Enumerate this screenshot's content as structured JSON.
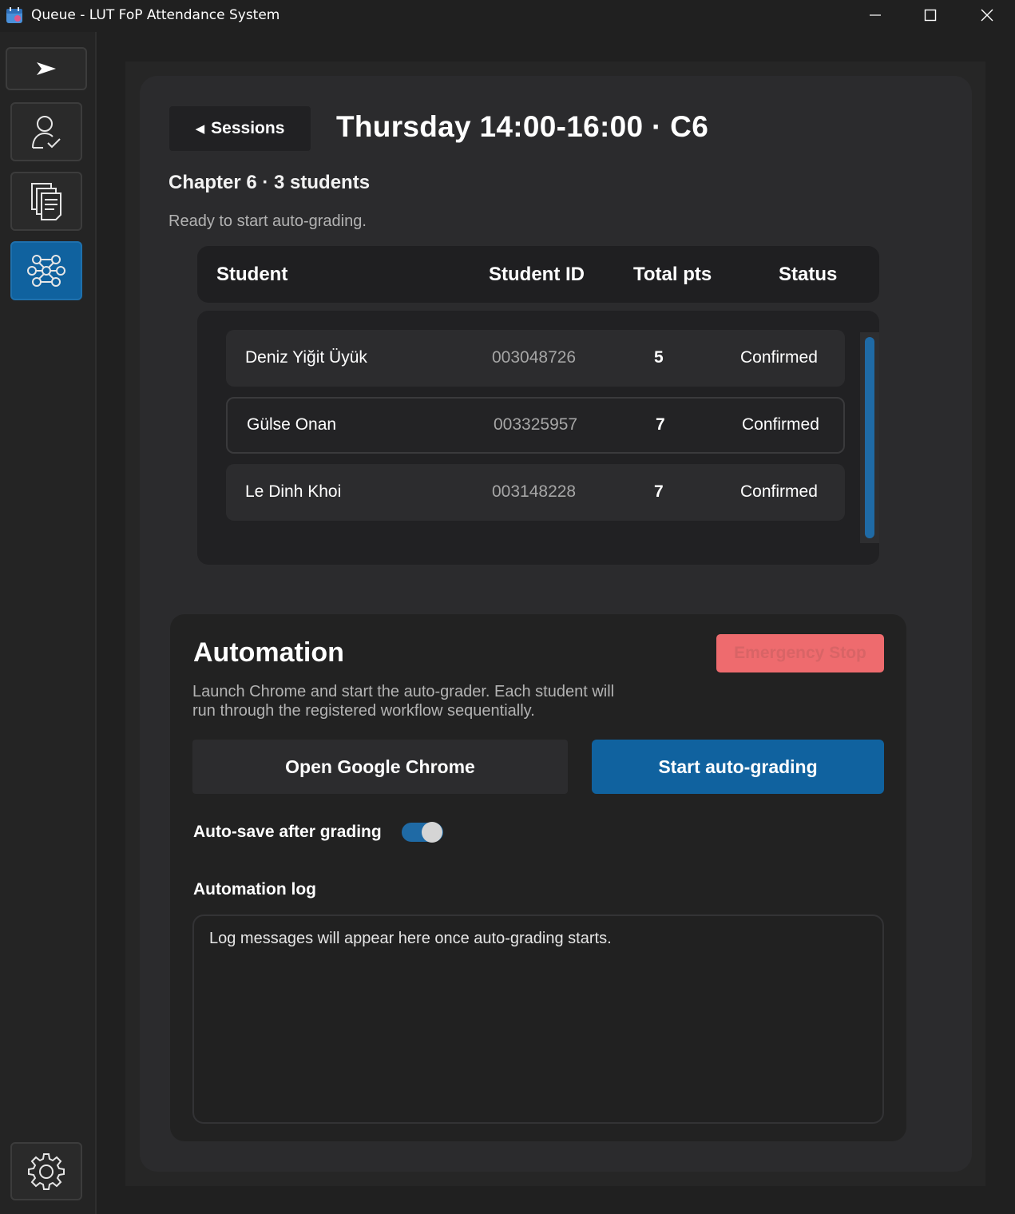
{
  "window": {
    "title": "Queue - LUT FoP Attendance System"
  },
  "sidebar": {
    "items": [
      {
        "icon": "send-arrow-icon",
        "active": false
      },
      {
        "icon": "user-check-icon",
        "active": false
      },
      {
        "icon": "documents-icon",
        "active": false
      },
      {
        "icon": "network-graph-icon",
        "active": true
      },
      {
        "icon": "gear-icon",
        "active": false
      }
    ]
  },
  "header": {
    "back_label": "Sessions",
    "title": "Thursday 14:00-16:00 · C6",
    "subheading": "Chapter 6 · 3 students",
    "status": "Ready to start auto-grading."
  },
  "table": {
    "columns": [
      "Student",
      "Student ID",
      "Total pts",
      "Status"
    ],
    "rows": [
      {
        "name": "Deniz Yiğit Üyük",
        "id": "003048726",
        "pts": "5",
        "status": "Confirmed"
      },
      {
        "name": "Gülse Onan",
        "id": "003325957",
        "pts": "7",
        "status": "Confirmed"
      },
      {
        "name": "Le Dinh Khoi",
        "id": "003148228",
        "pts": "7",
        "status": "Confirmed"
      }
    ]
  },
  "automation": {
    "title": "Automation",
    "emergency_label": "Emergency Stop",
    "description": "Launch Chrome and start the auto-grader. Each student will run through the registered workflow sequentially.",
    "open_chrome_label": "Open Google Chrome",
    "start_label": "Start auto-grading",
    "autosave_label": "Auto-save after grading",
    "autosave_on": true,
    "log_label": "Automation log",
    "log_text": "Log messages will appear here once auto-grading starts."
  },
  "colors": {
    "accent": "#10629f",
    "danger": "#ee6b6e",
    "background": "#202020"
  }
}
